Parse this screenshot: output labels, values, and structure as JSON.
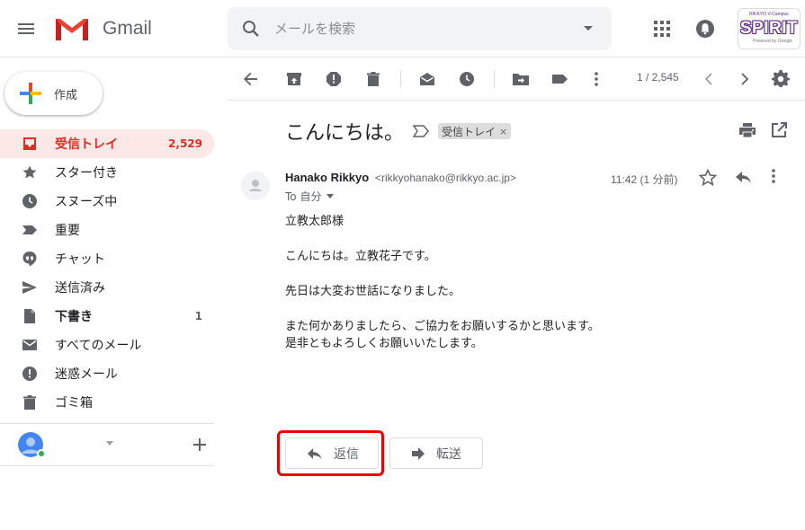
{
  "header": {
    "app_name": "Gmail",
    "search_placeholder": "メールを検索",
    "logo_badge": {
      "top": "RIKKYO V-Campus",
      "main": "SPIRIT",
      "bottom": "Powered by Google"
    }
  },
  "sidebar": {
    "compose_label": "作成",
    "items": [
      {
        "label": "受信トレイ",
        "count": "2,529",
        "icon": "inbox-icon",
        "active": true
      },
      {
        "label": "スター付き",
        "count": "",
        "icon": "star-icon"
      },
      {
        "label": "スヌーズ中",
        "count": "",
        "icon": "clock-icon"
      },
      {
        "label": "重要",
        "count": "",
        "icon": "important-icon"
      },
      {
        "label": "チャット",
        "count": "",
        "icon": "chat-icon"
      },
      {
        "label": "送信済み",
        "count": "",
        "icon": "send-icon"
      },
      {
        "label": "下書き",
        "count": "1",
        "icon": "draft-icon",
        "bold": true
      },
      {
        "label": "すべてのメール",
        "count": "",
        "icon": "mail-icon"
      },
      {
        "label": "迷惑メール",
        "count": "",
        "icon": "spam-icon"
      },
      {
        "label": "ゴミ箱",
        "count": "",
        "icon": "trash-icon"
      }
    ]
  },
  "toolbar": {
    "pager": "1 / 2,545"
  },
  "message": {
    "subject": "こんにちは。",
    "label_chip": "受信トレイ",
    "label_remove": "×",
    "sender_name": "Hanako Rikkyo",
    "sender_email": "<rikkyohanako@rikkyo.ac.jp>",
    "to": "To 自分",
    "time": "11:42 (1 分前)",
    "body": {
      "line1": "立教太郎様",
      "line2": "こんにちは。立教花子です。",
      "line3": "先日は大変お世話になりました。",
      "line4": "また何かありましたら、ご協力をお願いするかと思います。",
      "line5": "是非ともよろしくお願いいたします。"
    }
  },
  "actions": {
    "reply_label": "返信",
    "forward_label": "転送"
  },
  "colors": {
    "active_bg": "#fce8e6",
    "active_fg": "#d93025",
    "highlight": "#ee0000"
  }
}
